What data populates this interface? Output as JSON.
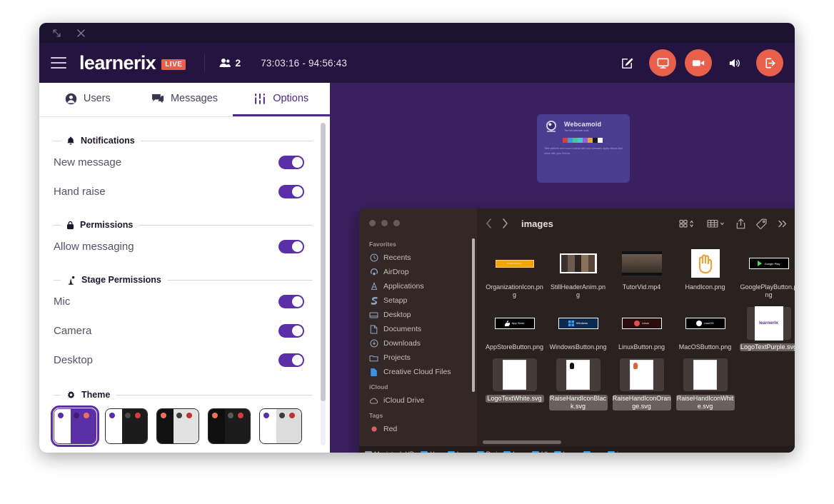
{
  "window": {
    "chrome": {
      "collapse_icon": "collapse-arrows-icon",
      "close_icon": "close-icon"
    }
  },
  "header": {
    "menu_icon": "hamburger-icon",
    "brand": "learnerix",
    "live_badge": "LIVE",
    "users_icon": "users-icon",
    "users_count": "2",
    "timer": "73:03:16 - 94:56:43",
    "actions": [
      {
        "name": "whiteboard-button",
        "icon": "pencil-square-icon",
        "accent": false
      },
      {
        "name": "screen-share-button",
        "icon": "monitor-icon",
        "accent": true
      },
      {
        "name": "camera-button",
        "icon": "video-camera-icon",
        "accent": true
      },
      {
        "name": "speaker-button",
        "icon": "speaker-icon",
        "accent": false
      },
      {
        "name": "leave-button",
        "icon": "logout-icon",
        "accent": true
      }
    ],
    "accent_color": "#e8604c",
    "bar_color": "#24143f"
  },
  "panel": {
    "tabs": [
      {
        "label": "Users",
        "icon": "user-circle-icon",
        "active": false
      },
      {
        "label": "Messages",
        "icon": "chat-bubble-icon",
        "active": false
      },
      {
        "label": "Options",
        "icon": "sliders-icon",
        "active": true
      }
    ],
    "sections": [
      {
        "title": "Notifications",
        "icon": "bell-icon",
        "rows": [
          {
            "label": "New message",
            "on": true
          },
          {
            "label": "Hand raise",
            "on": true
          }
        ]
      },
      {
        "title": "Permissions",
        "icon": "lock-icon",
        "rows": [
          {
            "label": "Allow messaging",
            "on": true
          }
        ]
      },
      {
        "title": "Stage Permissions",
        "icon": "stage-icon",
        "rows": [
          {
            "label": "Mic",
            "on": true
          },
          {
            "label": "Camera",
            "on": true
          },
          {
            "label": "Desktop",
            "on": true
          }
        ]
      }
    ],
    "theme": {
      "title": "Theme",
      "icon": "gear-icon",
      "swatches": [
        {
          "name": "theme-purple-light",
          "selected": true,
          "left_bg": "#ffffff",
          "left_dot": "#5b2fa5",
          "right_bg": "#5b2fa5",
          "dot1": "#3b1f73",
          "dot2": "#f1705a"
        },
        {
          "name": "theme-dark-1",
          "selected": false,
          "left_bg": "#ffffff",
          "left_dot": "#5b2fa5",
          "right_bg": "#1c1c1c",
          "dot1": "#4a4a4a",
          "dot2": "#d93b3b"
        },
        {
          "name": "theme-dark-light",
          "selected": false,
          "left_bg": "#111111",
          "left_dot": "#f1705a",
          "right_bg": "#e2e2e2",
          "dot1": "#3d3d3d",
          "dot2": "#c32f2f"
        },
        {
          "name": "theme-dark-2",
          "selected": false,
          "left_bg": "#0f0f0f",
          "left_dot": "#f1705a",
          "right_bg": "#1c1c1c",
          "dot1": "#5a5a5a",
          "dot2": "#d93b3b"
        },
        {
          "name": "theme-purple-gray",
          "selected": false,
          "left_bg": "#ffffff",
          "left_dot": "#5b2fa5",
          "right_bg": "#dcdcdc",
          "dot1": "#3d3d3d",
          "dot2": "#c32f2f"
        },
        {
          "name": "theme-blue",
          "selected": false,
          "left_bg": "#ffffff",
          "left_dot": "#2b7fe0",
          "right_bg": "#17386e",
          "dot1": "#3f9be0",
          "dot2": "#6fc6ef"
        },
        {
          "name": "theme-red",
          "selected": false,
          "left_bg": "#ffffff",
          "left_dot": "#d01f1f",
          "right_bg": "#8e2424",
          "dot1": "#5a0f0f",
          "dot2": "#f0302a"
        },
        {
          "name": "theme-green",
          "selected": false,
          "left_bg": "#ffffff",
          "left_dot": "#176b43",
          "right_bg": "#125c2a",
          "dot1": "#0b3a18",
          "dot2": "#6ed03a"
        }
      ]
    }
  },
  "stage": {
    "background_color": "#3b2060",
    "webcam_card": {
      "title": "Webcamoid",
      "subtitle": "The full webcam suite",
      "body": "Take pictures and record videos with your webcam, apply effects and share with your friends.",
      "bar_colors": [
        "#e03b3b",
        "#3f9be0",
        "#4ec58f",
        "#42c8d6",
        "#9b5bd6",
        "#e8a33d",
        "#1b1b1b",
        "#ffffff"
      ]
    },
    "finder": {
      "title": "images",
      "back_icon": "chevron-left-icon",
      "forward_icon": "chevron-right-icon",
      "toolbar_icons": [
        "grid-view-icon",
        "group-by-icon",
        "share-icon",
        "tag-icon",
        "more-icon",
        "search-icon"
      ],
      "sidebar": [
        {
          "group": "Favorites",
          "items": [
            {
              "label": "Recents",
              "icon": "clock-icon"
            },
            {
              "label": "AirDrop",
              "icon": "airdrop-icon"
            },
            {
              "label": "Applications",
              "icon": "applications-icon"
            },
            {
              "label": "Setapp",
              "icon": "setapp-icon"
            },
            {
              "label": "Desktop",
              "icon": "desktop-icon"
            },
            {
              "label": "Documents",
              "icon": "document-icon"
            },
            {
              "label": "Downloads",
              "icon": "download-icon"
            },
            {
              "label": "Projects",
              "icon": "folder-icon"
            },
            {
              "label": "Creative Cloud Files",
              "icon": "creative-cloud-icon"
            }
          ]
        },
        {
          "group": "iCloud",
          "items": [
            {
              "label": "iCloud Drive",
              "icon": "cloud-icon"
            }
          ]
        },
        {
          "group": "Tags",
          "items": [
            {
              "label": "Red",
              "icon": "red-tag-icon"
            }
          ]
        }
      ],
      "files": [
        {
          "name": "OrganizationIcon.png",
          "thumb": "orange-bar",
          "selected": false
        },
        {
          "name": "StillHeaderAnim.png",
          "thumb": "photo",
          "selected": false
        },
        {
          "name": "TutorVid.mp4",
          "thumb": "video",
          "selected": false
        },
        {
          "name": "HandIcon.png",
          "thumb": "hand",
          "selected": false
        },
        {
          "name": "GooglePlayButton.png",
          "thumb": "googleplay",
          "selected": false
        },
        {
          "name": "AppStoreButton.png",
          "thumb": "appstore",
          "selected": false
        },
        {
          "name": "WindowsButton.png",
          "thumb": "windows",
          "selected": false
        },
        {
          "name": "LinuxButton.png",
          "thumb": "linux",
          "selected": false
        },
        {
          "name": "MacOSButton.png",
          "thumb": "macos",
          "selected": false
        },
        {
          "name": "LogoTextPurple.svg",
          "thumb": "logo-purple",
          "selected": true
        },
        {
          "name": "LogoTextWhite.svg",
          "thumb": "doc-blank",
          "selected": true
        },
        {
          "name": "RaiseHandIconBlack.svg",
          "thumb": "doc-black-mark",
          "selected": true
        },
        {
          "name": "RaiseHandIconOrange.svg",
          "thumb": "doc-orange-mark",
          "selected": true
        },
        {
          "name": "RaiseHandIconWhite.svg",
          "thumb": "doc-blank",
          "selected": true
        }
      ],
      "breadcrumbs": [
        {
          "label": "Macintosh HD",
          "icon": "hard-drive-icon"
        },
        {
          "label": "Use",
          "icon": "folder-icon"
        },
        {
          "label": "hass",
          "icon": "folder-icon"
        },
        {
          "label": "Proj",
          "icon": "folder-icon"
        },
        {
          "label": "Lear",
          "icon": "folder-icon"
        },
        {
          "label": "UI",
          "icon": "folder-icon"
        },
        {
          "label": "learn",
          "icon": "folder-icon"
        },
        {
          "label": "src",
          "icon": "folder-icon"
        },
        {
          "label": "images",
          "icon": "folder-icon"
        }
      ]
    }
  }
}
